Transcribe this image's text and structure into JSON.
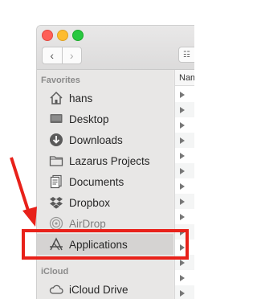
{
  "toolbar": {
    "back_glyph": "‹",
    "forward_glyph": "›",
    "view_glyph": "☷"
  },
  "sidebar": {
    "favorites_heading": "Favorites",
    "icloud_heading": "iCloud",
    "items": [
      {
        "label": "hans",
        "icon": "home-icon"
      },
      {
        "label": "Desktop",
        "icon": "desktop-icon"
      },
      {
        "label": "Downloads",
        "icon": "downloads-icon"
      },
      {
        "label": "Lazarus Projects",
        "icon": "folder-icon"
      },
      {
        "label": "Documents",
        "icon": "documents-icon"
      },
      {
        "label": "Dropbox",
        "icon": "dropbox-icon"
      },
      {
        "label": "AirDrop",
        "icon": "airdrop-icon"
      },
      {
        "label": "Applications",
        "icon": "applications-icon"
      }
    ],
    "icloud_items": [
      {
        "label": "iCloud Drive",
        "icon": "cloud-icon"
      }
    ]
  },
  "content": {
    "column_header": "Nam"
  },
  "colors": {
    "annotation": "#e8211a",
    "traffic_close": "#fe5f57",
    "traffic_min": "#febc2e",
    "traffic_max": "#28c840"
  }
}
